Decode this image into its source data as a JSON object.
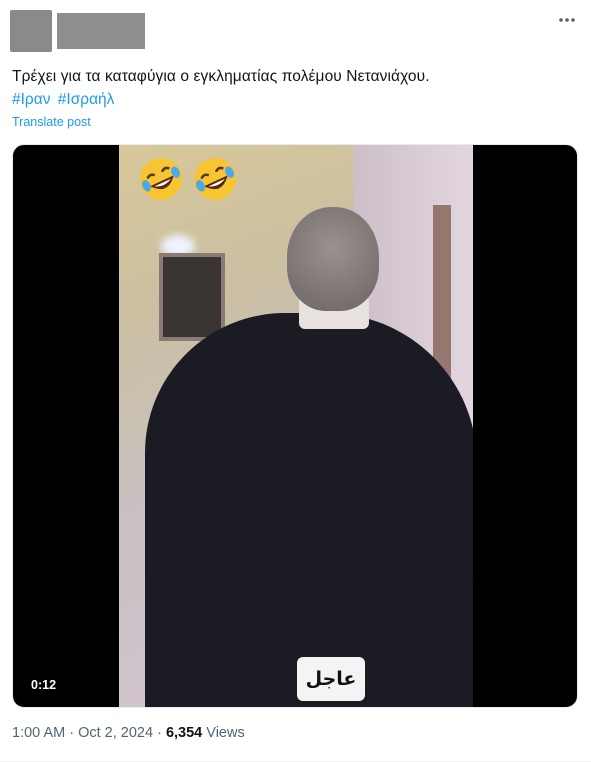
{
  "post": {
    "text": "Τρέχει για τα καταφύγια ο εγκληματίας πολέμου Νετανιάχου.",
    "hashtags": [
      "#Ιραν",
      "#Ισραήλ"
    ],
    "translate_label": "Translate post"
  },
  "media": {
    "duration": "0:12",
    "caption_badge": "عاجل",
    "emoji_icon": "rolling-on-floor-laughing-emoji"
  },
  "meta": {
    "time": "1:00 AM",
    "separator": " · ",
    "date": "Oct 2, 2024",
    "separator2": " · ",
    "views_count": "6,354",
    "views_label": " Views"
  },
  "icons": {
    "more": "more-horizontal-icon"
  },
  "colors": {
    "link": "#1d9bf0",
    "text": "#0f1419",
    "muted": "#536471"
  }
}
